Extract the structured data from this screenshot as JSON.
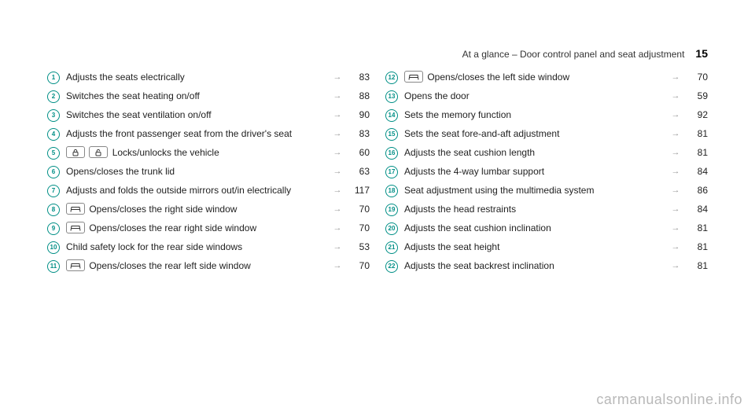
{
  "header": {
    "title": "At a glance – Door control panel and seat adjustment",
    "page_number": "15"
  },
  "arrow_glyph": "→",
  "left_items": [
    {
      "n": "1",
      "icons": [],
      "text": "Adjusts the seats electrically",
      "page": "83"
    },
    {
      "n": "2",
      "icons": [],
      "text": "Switches the seat heating on/off",
      "page": "88"
    },
    {
      "n": "3",
      "icons": [],
      "text": "Switches the seat ventilation on/off",
      "page": "90"
    },
    {
      "n": "4",
      "icons": [],
      "text": "Adjusts the front passenger seat from the driv­er's seat",
      "page": "83"
    },
    {
      "n": "5",
      "icons": [
        "lock-closed",
        "lock-open"
      ],
      "text": "Locks/unlocks the vehicle",
      "page": "60"
    },
    {
      "n": "6",
      "icons": [],
      "text": "Opens/closes the trunk lid",
      "page": "63"
    },
    {
      "n": "7",
      "icons": [],
      "text": "Adjusts and folds the outside mirrors out/in electrically",
      "page": "117"
    },
    {
      "n": "8",
      "icons": [
        "window"
      ],
      "text": "Opens/closes the right side window",
      "page": "70"
    },
    {
      "n": "9",
      "icons": [
        "window"
      ],
      "text": "Opens/closes the rear right side window",
      "page": "70"
    },
    {
      "n": "10",
      "icons": [],
      "text": "Child safety lock for the rear side windows",
      "page": "53"
    },
    {
      "n": "11",
      "icons": [
        "window"
      ],
      "text": "Opens/closes the rear left side window",
      "page": "70"
    }
  ],
  "right_items": [
    {
      "n": "12",
      "icons": [
        "window"
      ],
      "text": "Opens/closes the left side window",
      "page": "70"
    },
    {
      "n": "13",
      "icons": [],
      "text": "Opens the door",
      "page": "59"
    },
    {
      "n": "14",
      "icons": [],
      "text": "Sets the memory function",
      "page": "92"
    },
    {
      "n": "15",
      "icons": [],
      "text": "Sets the seat fore-and-aft adjustment",
      "page": "81"
    },
    {
      "n": "16",
      "icons": [],
      "text": "Adjusts the seat cushion length",
      "page": "81"
    },
    {
      "n": "17",
      "icons": [],
      "text": "Adjusts the 4-way lumbar support",
      "page": "84"
    },
    {
      "n": "18",
      "icons": [],
      "text": "Seat adjustment using the multimedia system",
      "page": "86"
    },
    {
      "n": "19",
      "icons": [],
      "text": "Adjusts the head restraints",
      "page": "84"
    },
    {
      "n": "20",
      "icons": [],
      "text": "Adjusts the seat cushion inclination",
      "page": "81"
    },
    {
      "n": "21",
      "icons": [],
      "text": "Adjusts the seat height",
      "page": "81"
    },
    {
      "n": "22",
      "icons": [],
      "text": "Adjusts the seat backrest inclination",
      "page": "81"
    }
  ],
  "watermark": "carmanualsonline.info"
}
